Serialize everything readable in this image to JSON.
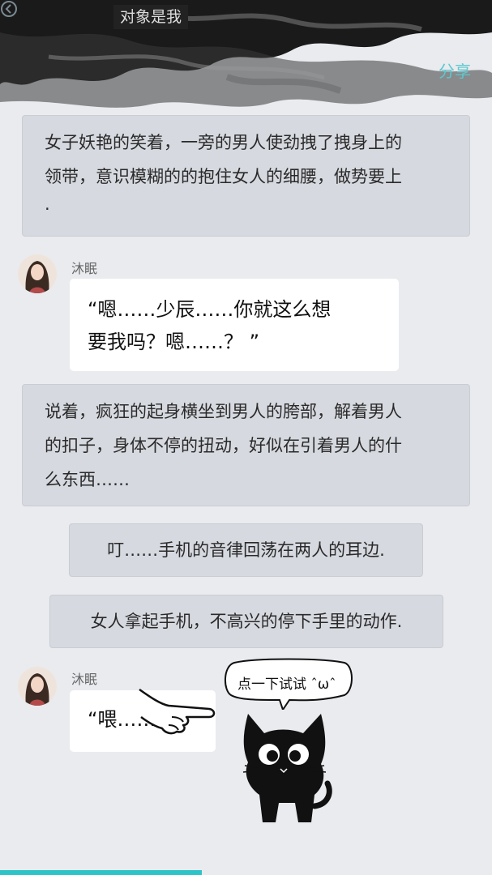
{
  "header": {
    "title": "对象是我",
    "share_label": "分享"
  },
  "messages": [
    {
      "type": "narration",
      "lines": [
        "女子妖艳的笑着，一旁的男人使劲拽了拽身上的",
        "领带，意识模糊的的抱住女人的细腰，做势要上",
        "."
      ]
    },
    {
      "type": "dialogue",
      "speaker": "沐眠",
      "lines": [
        "“嗯……少辰……你就这么想",
        "要我吗？嗯……？ ”"
      ]
    },
    {
      "type": "narration",
      "lines": [
        "说着，疯狂的起身横坐到男人的胯部，解着男人",
        "的扣子，身体不停的扭动，好似在引着男人的什",
        "么东西……"
      ]
    },
    {
      "type": "narration",
      "lines": [
        "叮……手机的音律回荡在两人的耳边."
      ]
    },
    {
      "type": "narration",
      "lines": [
        "女人拿起手机，不高兴的停下手里的动作."
      ]
    },
    {
      "type": "dialogue",
      "speaker": "沐眠",
      "lines": [
        "“喂……"
      ]
    }
  ],
  "hint": {
    "text": "点一下试试 ˆωˆ",
    "icons": [
      "pointing-hand-icon",
      "black-cat-icon"
    ]
  },
  "progress": {
    "fraction": 0.41,
    "color": "#2ec3c9"
  },
  "colors": {
    "background": "#e9ebef",
    "narration_bg": "#d6d9df",
    "bubble_bg": "#ffffff",
    "accent": "#5cc8ce"
  }
}
